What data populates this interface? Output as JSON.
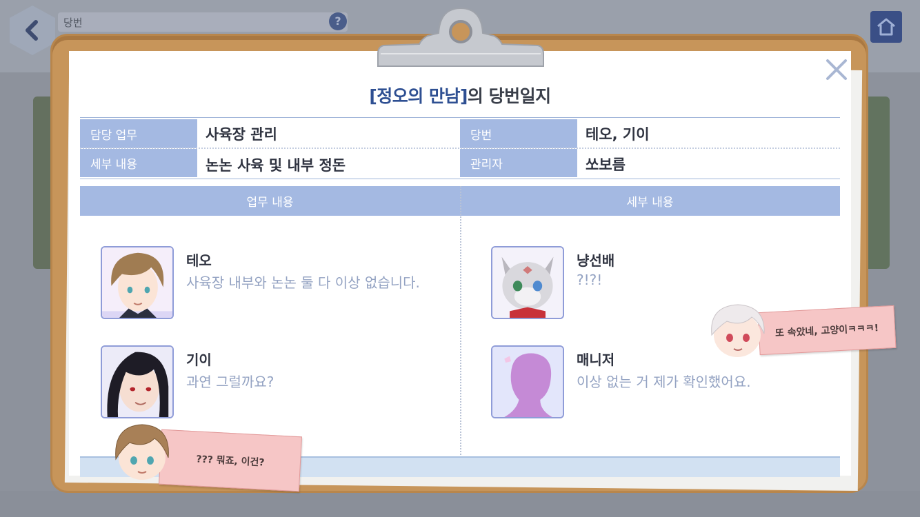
{
  "top_bar": {
    "back_icon": "chevron-left-icon",
    "title": "당번",
    "help_icon": "question-icon",
    "home_icon": "home-icon"
  },
  "dialog": {
    "title_highlight": "[정오의 만남]",
    "title_rest": "의 당번일지",
    "close_icon": "close-icon",
    "info": {
      "duty_label": "담당 업무",
      "duty_value": "사육장 관리",
      "detail_label": "세부 내용",
      "detail_value": "논논 사육 및 내부 정돈",
      "shift_label": "당번",
      "shift_value": "테오, 기이",
      "manager_label": "관리자",
      "manager_value": "쏘보름"
    },
    "columns": {
      "left_header": "업무 내용",
      "right_header": "세부 내용"
    },
    "entries_left": [
      {
        "name": "테오",
        "line": "사육장 내부와 논논 둘 다 이상 없습니다."
      },
      {
        "name": "기이",
        "line": "과연 그럴까요?"
      }
    ],
    "entries_right": [
      {
        "name": "냥선배",
        "line": "?!?!"
      },
      {
        "name": "매니저",
        "line": "이상 없는 거 제가 확인했어요."
      }
    ],
    "notes": {
      "right_note": "또 속았네, 고양이ㅋㅋㅋ!",
      "left_note": "??? 뭐죠, 이건?"
    }
  },
  "colors": {
    "header_blue": "#a4b9e2",
    "title_highlight": "#2e4f92",
    "dialog_line_text": "#93a2c2",
    "clipboard": "#c7955a",
    "note_pink": "#f6c6c6"
  }
}
